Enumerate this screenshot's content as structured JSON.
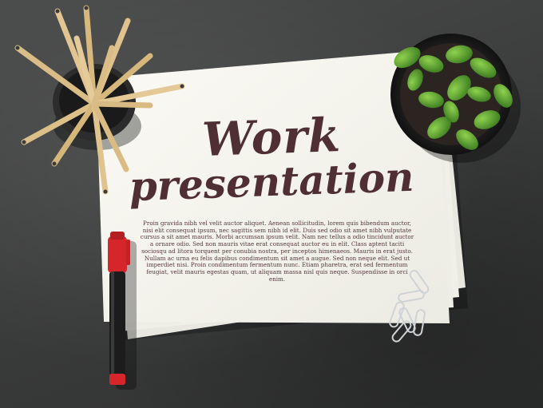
{
  "headline": {
    "line1": "Work",
    "line2": "presentation"
  },
  "body_text": "Proin gravida nibh vel velit auctor aliquet. Aenean sollicitudin, lorem quis bibendum auctor, nisi elit consequat ipsum, nec sagittis sem nibh id elit. Duis sed odio sit amet nibh vulputate cursus a sit amet mauris. Morbi accumsan ipsum velit. Nam nec tellus a odio tincidunt auctor a ornare odio. Sed non mauris vitae erat consequat auctor eu in elit. Class aptent taciti sociosqu ad litora torquent per conubia nostra, per inceptos himenaeos. Mauris in erat justo. Nullam ac urna eu felis dapibus condimentum sit amet a augue. Sed non neque elit. Sed ut imperdiet nisi. Proin condimentum fermentum nunc. Etiam pharetra, erat sed fermentum feugiat, velit mauris egestas quam, ut aliquam massa nisl quis neque. Suspendisse in orci enim.",
  "colors": {
    "desk": "#3d3e3e",
    "paper": "#f6f5ee",
    "ink": "#4f2f33",
    "marker_cap": "#d6262b",
    "marker_body": "#1c1c1c",
    "pencil_wood": "#dcbf89",
    "plant": "#4e9a2c"
  },
  "icons": [
    "pencil-cup",
    "potted-plant",
    "marker",
    "paper-clips"
  ]
}
